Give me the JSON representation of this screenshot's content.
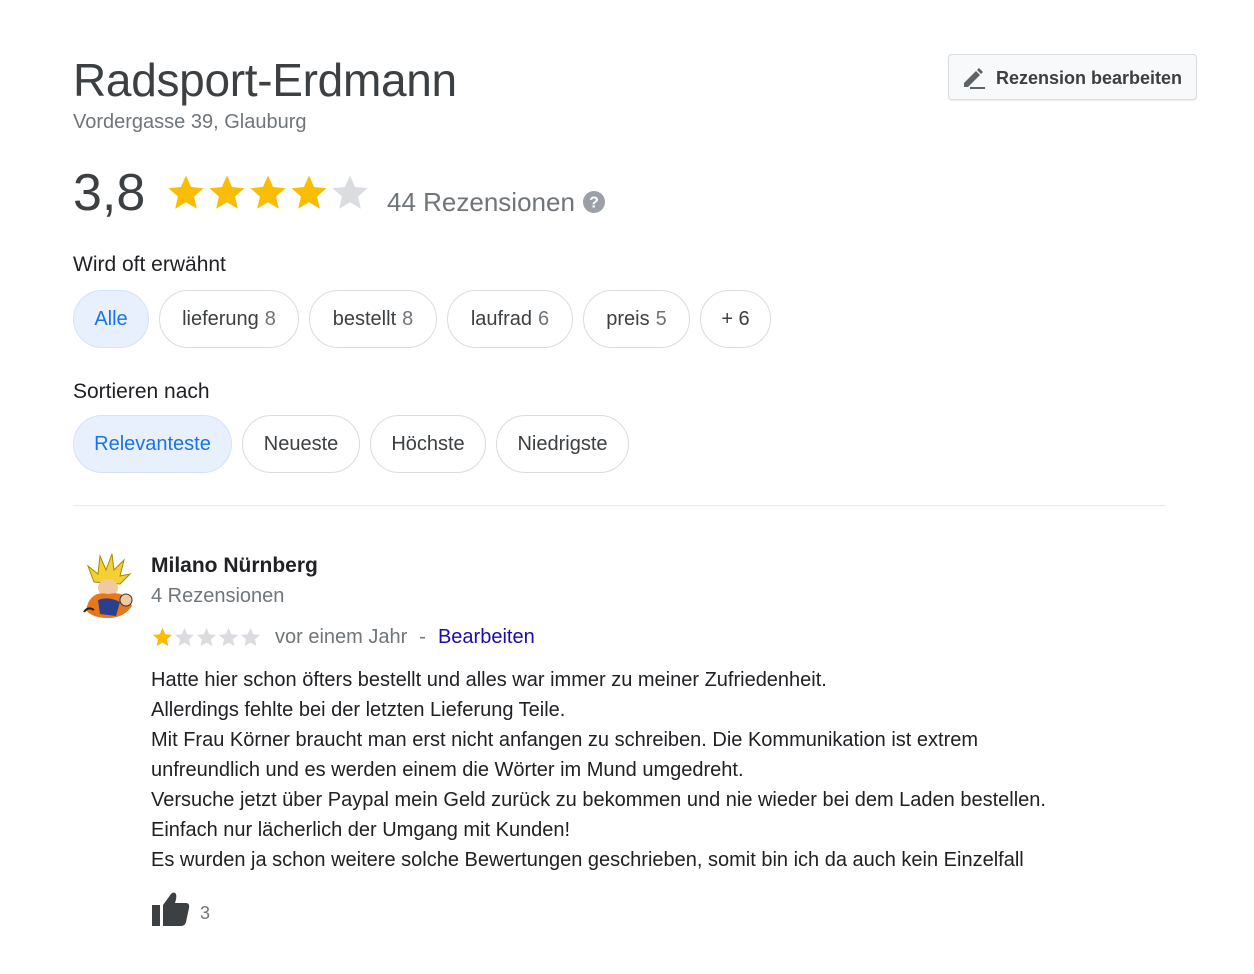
{
  "business": {
    "name": "Radsport-Erdmann",
    "address": "Vordergasse 39, Glauburg",
    "edit_review_label": "Rezension bearbeiten",
    "edit_icon": "pencil-icon"
  },
  "rating": {
    "value": "3,8",
    "stars_filled": 4,
    "stars_total": 5,
    "review_count_text": "44 Rezensionen",
    "help_icon": "help-circle-icon"
  },
  "mentions": {
    "label": "Wird oft erwähnt",
    "chips": [
      {
        "label": "Alle",
        "count": "",
        "active": true
      },
      {
        "label": "lieferung",
        "count": "8",
        "active": false
      },
      {
        "label": "bestellt",
        "count": "8",
        "active": false
      },
      {
        "label": "laufrad",
        "count": "6",
        "active": false
      },
      {
        "label": "preis",
        "count": "5",
        "active": false
      },
      {
        "label": "+ 6",
        "count": "",
        "active": false
      }
    ]
  },
  "sort": {
    "label": "Sortieren nach",
    "options": [
      {
        "label": "Relevanteste",
        "active": true
      },
      {
        "label": "Neueste",
        "active": false
      },
      {
        "label": "Höchste",
        "active": false
      },
      {
        "label": "Niedrigste",
        "active": false
      }
    ]
  },
  "review": {
    "author": "Milano Nürnberg",
    "author_reviews": "4 Rezensionen",
    "stars_filled": 1,
    "stars_total": 5,
    "time": "vor einem Jahr",
    "separator": "-",
    "edit_label": "Bearbeiten",
    "text_lines": [
      "Hatte hier schon öfters bestellt und alles war immer zu meiner Zufriedenheit.",
      "Allerdings fehlte bei der letzten Lieferung Teile.",
      "Mit Frau Körner braucht man erst nicht anfangen zu schreiben. Die Kommunikation ist extrem",
      "unfreundlich und es werden einem die Wörter im Mund umgedreht.",
      "Versuche jetzt über Paypal mein Geld zurück zu bekommen und nie wieder bei dem Laden bestellen.",
      "Einfach nur lächerlich der Umgang mit Kunden!",
      "Es wurden ja schon weitere solche Bewertungen geschrieben, somit bin ich da auch kein Einzelfall"
    ],
    "likes": "3",
    "like_icon": "thumbs-up-icon"
  },
  "colors": {
    "star_filled": "#fbbc04",
    "star_empty": "#dadce0",
    "accent": "#1a73e8",
    "link": "#1a0dab"
  }
}
